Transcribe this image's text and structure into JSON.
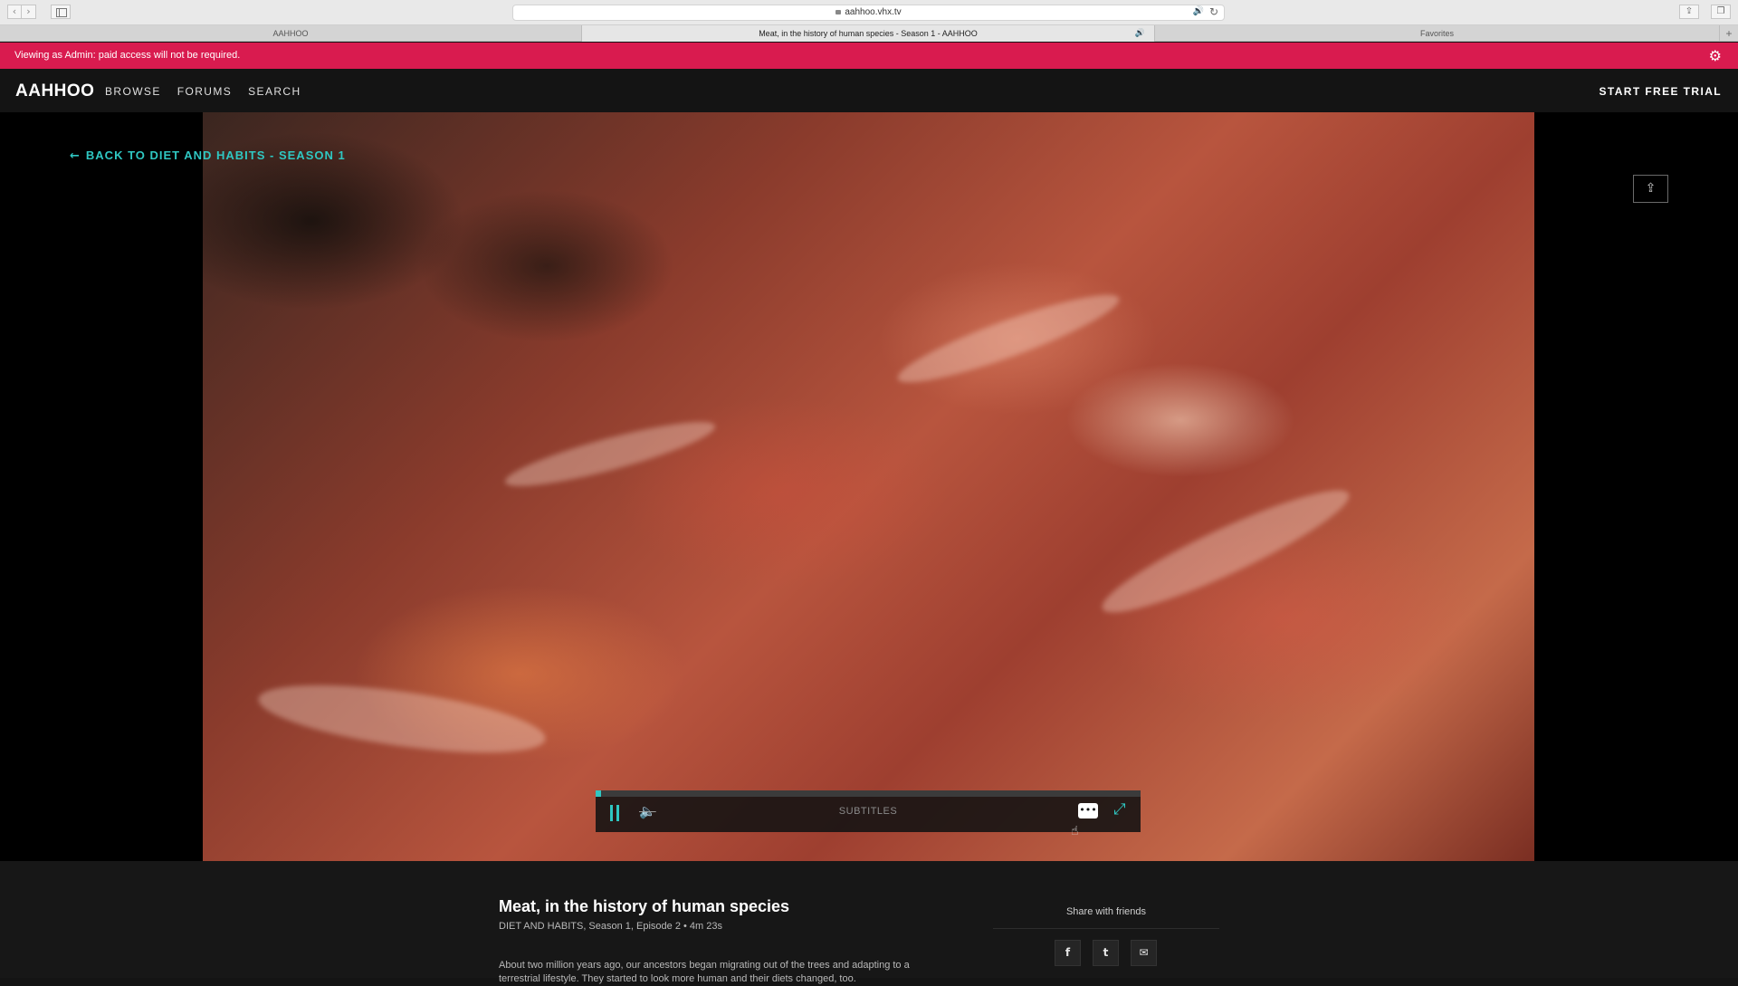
{
  "browser": {
    "url": "aahhoo.vhx.tv",
    "nav_back_glyph": "‹",
    "nav_forward_glyph": "›",
    "audio_glyph": "🔊",
    "reload_glyph": "↻",
    "share_glyph": "⇪",
    "tabs_glyph": "❐",
    "tabs": [
      {
        "label": "AAHHOO",
        "active": false
      },
      {
        "label": "Meat, in the history of human species - Season 1 - AAHHOO",
        "active": true
      },
      {
        "label": "Favorites",
        "active": false
      }
    ],
    "new_tab_glyph": "+"
  },
  "admin_banner": {
    "text": "Viewing as Admin: paid access will not be required.",
    "color": "#d91b4f"
  },
  "header": {
    "logo": "AAHHOO",
    "nav": [
      "BROWSE",
      "FORUMS",
      "SEARCH"
    ],
    "cta": "START FREE TRIAL"
  },
  "player": {
    "back_link": "BACK TO DIET AND HABITS - SEASON 1",
    "back_arrow": "←",
    "share_glyph": "⇪",
    "progress": 0.01,
    "subtitles_label": "SUBTITLES",
    "accent_color": "#2fc7c2",
    "volume_glyph": "🔈",
    "fullscreen_glyph": "⤢",
    "cursor_glyph": "☝"
  },
  "episode": {
    "title": "Meat, in the history of human species",
    "meta": "DIET AND HABITS, Season 1, Episode 2 • 4m 23s",
    "description": "About two million years ago, our ancestors began migrating out of the trees and adapting to a terrestrial lifestyle. They started to look more human and their diets changed, too."
  },
  "share": {
    "title": "Share with friends",
    "facebook": "f",
    "twitter": "t",
    "email": "✉"
  }
}
